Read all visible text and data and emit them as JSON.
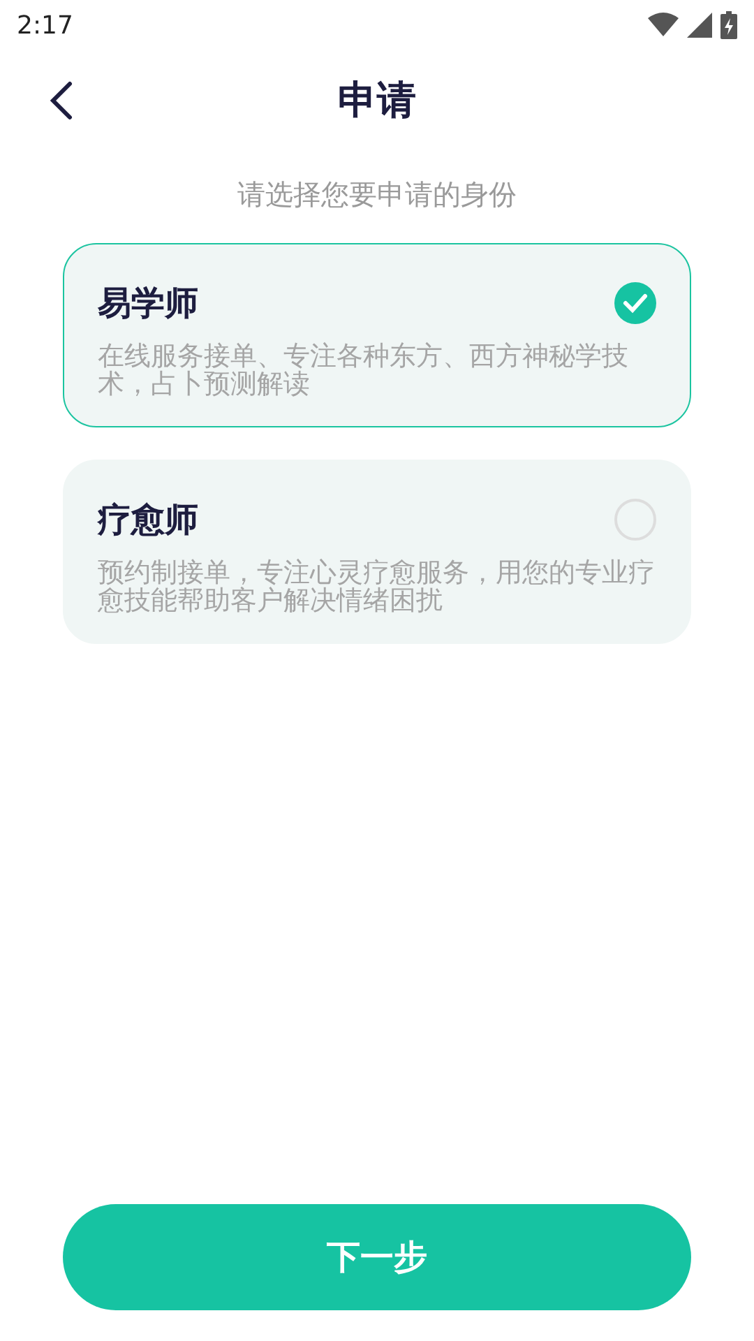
{
  "status_bar": {
    "time": "2:17"
  },
  "header": {
    "title": "申请"
  },
  "prompt": "请选择您要申请的身份",
  "options": [
    {
      "title": "易学师",
      "description": "在线服务接单、专注各种东方、西方神秘学技术，占卜预测解读",
      "selected": true
    },
    {
      "title": "疗愈师",
      "description": "预约制接单，专注心灵疗愈服务，用您的专业疗愈技能帮助客户解决情绪困扰",
      "selected": false
    }
  ],
  "next_button": "下一步"
}
